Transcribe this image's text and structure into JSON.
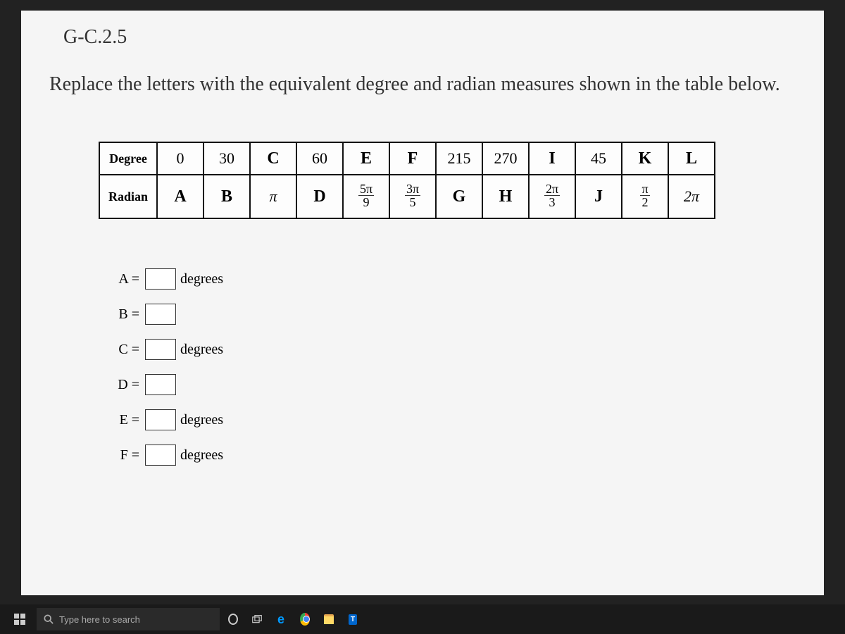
{
  "header": {
    "code": "G-C.2.5"
  },
  "instructions": "Replace the letters with the equivalent degree and radian measures shown in the table below.",
  "table": {
    "row_labels": [
      "Degree",
      "Radian"
    ],
    "degree_row": [
      {
        "text": "0",
        "letter": false
      },
      {
        "text": "30",
        "letter": false
      },
      {
        "text": "C",
        "letter": true
      },
      {
        "text": "60",
        "letter": false
      },
      {
        "text": "E",
        "letter": true
      },
      {
        "text": "F",
        "letter": true
      },
      {
        "text": "215",
        "letter": false
      },
      {
        "text": "270",
        "letter": false
      },
      {
        "text": "I",
        "letter": true
      },
      {
        "text": "45",
        "letter": false
      },
      {
        "text": "K",
        "letter": true
      },
      {
        "text": "L",
        "letter": true
      }
    ],
    "radian_row": [
      {
        "type": "letter",
        "text": "A"
      },
      {
        "type": "letter",
        "text": "B"
      },
      {
        "type": "plain",
        "text": "π"
      },
      {
        "type": "letter",
        "text": "D"
      },
      {
        "type": "frac",
        "num": "5π",
        "den": "9"
      },
      {
        "type": "frac",
        "num": "3π",
        "den": "5"
      },
      {
        "type": "letter",
        "text": "G"
      },
      {
        "type": "letter",
        "text": "H"
      },
      {
        "type": "frac",
        "num": "2π",
        "den": "3"
      },
      {
        "type": "letter",
        "text": "J"
      },
      {
        "type": "frac",
        "num": "π",
        "den": "2"
      },
      {
        "type": "plain",
        "text": "2π"
      }
    ]
  },
  "answers": [
    {
      "label": "A =",
      "unit": "degrees"
    },
    {
      "label": "B =",
      "unit": ""
    },
    {
      "label": "C =",
      "unit": "degrees"
    },
    {
      "label": "D =",
      "unit": ""
    },
    {
      "label": "E =",
      "unit": "degrees"
    },
    {
      "label": "F =",
      "unit": "degrees"
    }
  ],
  "taskbar": {
    "search_placeholder": "Type here to search",
    "texmaker": "T"
  }
}
